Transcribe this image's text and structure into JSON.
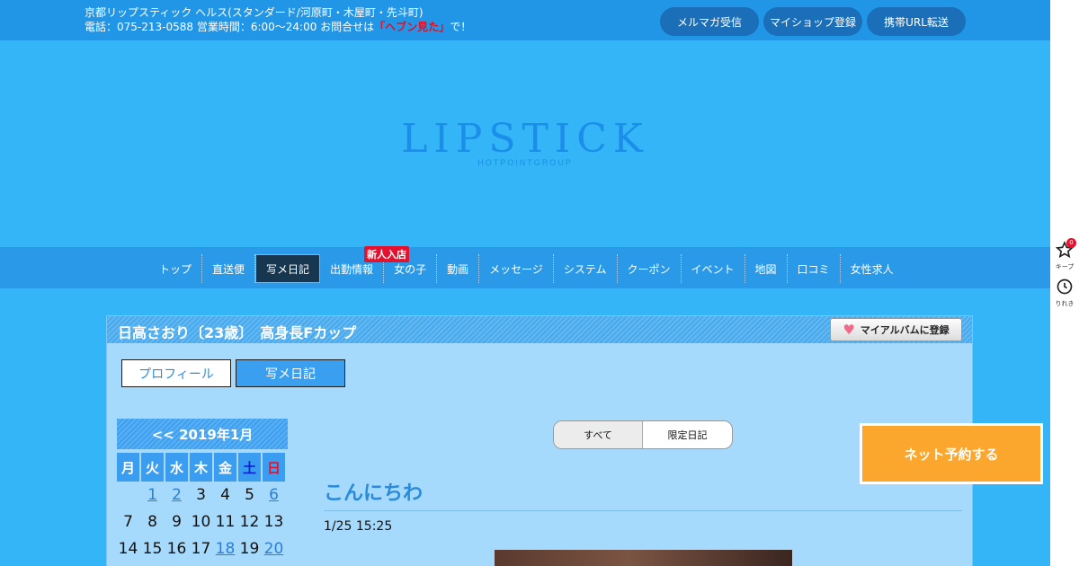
{
  "header": {
    "line1": "京都リップスティック ヘルス(スタンダード/河原町・木屋町・先斗町)",
    "line2_prefix": "電話：075-213-0588 営業時間：6:00～24:00 お問合せは",
    "line2_highlight": "「ヘブン見た」",
    "line2_suffix": "で！",
    "buttons": [
      "メルマガ受信",
      "マイショップ登録",
      "携帯URL転送"
    ]
  },
  "logo": {
    "main": "LIPSTICK",
    "sub": "HOTPOINTGROUP"
  },
  "nav": {
    "items": [
      "トップ",
      "直送便",
      "写メ日記",
      "出勤情報",
      "女の子",
      "動画",
      "メッセージ",
      "システム",
      "クーポン",
      "イベント",
      "地図",
      "口コミ",
      "女性求人"
    ],
    "badge": "新人入店"
  },
  "profile": {
    "title": "日高さおり〔23歳〕　高身長Fカップ",
    "album_button": "マイアルバムに登録",
    "tabs": [
      "プロフィール",
      "写メ日記"
    ]
  },
  "calendar": {
    "header": "<< 2019年1月",
    "dows": [
      "月",
      "火",
      "水",
      "木",
      "金",
      "土",
      "日"
    ],
    "rows": [
      [
        "",
        "1",
        "2",
        "3",
        "4",
        "5",
        "6"
      ],
      [
        "7",
        "8",
        "9",
        "10",
        "11",
        "12",
        "13"
      ],
      [
        "14",
        "15",
        "16",
        "17",
        "18",
        "19",
        "20"
      ]
    ],
    "linked": [
      "1",
      "2",
      "6",
      "18",
      "20"
    ]
  },
  "diary": {
    "filters": [
      "すべて",
      "限定日記"
    ],
    "post_title": "こんにちわ",
    "post_date": "1/25 15:25"
  },
  "reserve_button": "ネット予約する",
  "sidebar": {
    "keep_label": "キープ",
    "keep_count": "0",
    "history_label": "りれき"
  },
  "colors": {
    "background": "#33b5f7",
    "topbar": "#2196e6",
    "accent_red": "#e0102a",
    "reserve": "#fba62c",
    "panel": "#a6dafc"
  }
}
